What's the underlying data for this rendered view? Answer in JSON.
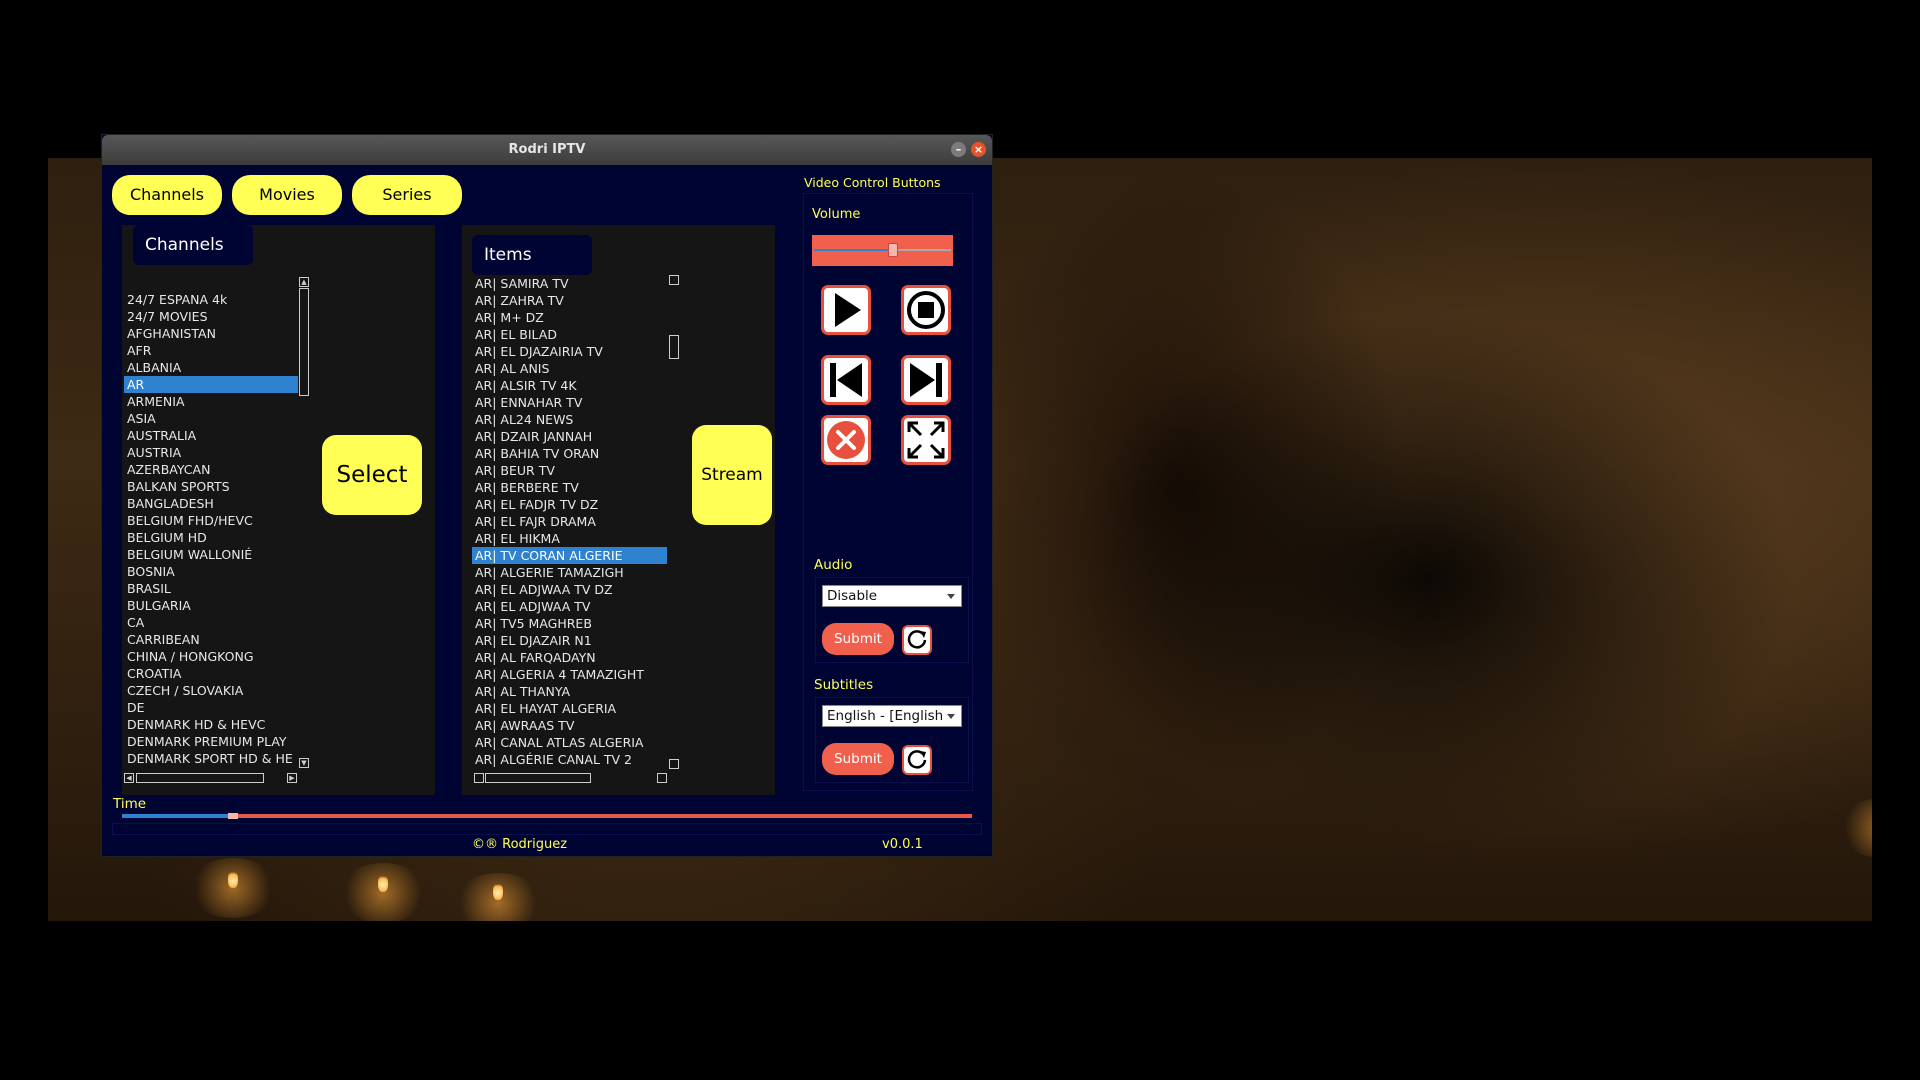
{
  "window": {
    "title": "Rodri IPTV"
  },
  "tabs": [
    {
      "label": "Channels"
    },
    {
      "label": "Movies"
    },
    {
      "label": "Series"
    }
  ],
  "channels_panel": {
    "label": "Channels",
    "items": [
      "24/7 ESPANA 4k",
      "24/7 MOVIES",
      "AFGHANISTAN",
      "AFR",
      "ALBANIA",
      "AR",
      "ARMENIA",
      "ASIA",
      "AUSTRALIA",
      "AUSTRIA",
      "AZERBAYCAN",
      "BALKAN SPORTS",
      "BANGLADESH",
      "BELGIUM FHD/HEVC",
      "BELGIUM HD",
      "BELGIUM WALLONIÉ",
      "BOSNIA",
      "BRASIL",
      "BULGARIA",
      "CA",
      "CARRIBEAN",
      "CHINA / HONGKONG",
      "CROATIA",
      "CZECH / SLOVAKIA",
      "DE",
      "DENMARK HD & HEVC",
      "DENMARK PREMIUM PLAY",
      "DENMARK SPORT HD & HE"
    ],
    "selected": "AR"
  },
  "select_button": "Select",
  "items_panel": {
    "label": "Items",
    "items": [
      "AR| SAMIRA TV",
      "AR| ZAHRA TV",
      "AR| M+ DZ",
      "AR| EL BILAD",
      "AR| EL DJAZAIRIA TV",
      "AR| AL ANIS",
      "AR|  ALSIR TV 4K",
      "AR| ENNAHAR TV",
      "AR| AL24 NEWS",
      "AR| DZAIR JANNAH",
      "AR| BAHIA TV ORAN",
      "AR| BEUR TV",
      "AR| BERBERE TV",
      "AR| EL FADJR TV DZ",
      "AR| EL FAJR DRAMA",
      "AR| EL HIKMA",
      "AR| TV CORAN ALGERIE",
      "AR| ALGERIE TAMAZIGH",
      "AR| EL ADJWAA TV DZ",
      "AR| EL ADJWAA TV",
      "AR| TV5 MAGHREB",
      "AR| EL DJAZAIR N1",
      "AR| AL FARQADAYN",
      "AR| ALGERIA 4 TAMAZIGHT",
      "AR| AL THANYA",
      "AR| EL HAYAT ALGERIA",
      "AR| AWRAAS TV",
      "AR| CANAL ATLAS ALGERIA",
      "AR| ALGÉRIE CANAL TV 2"
    ],
    "selected": "AR| TV CORAN ALGERIE"
  },
  "stream_button": "Stream",
  "controls": {
    "heading": "Video Control Buttons",
    "volume_label": "Volume",
    "volume_level": 0.58,
    "buttons": [
      "play-icon",
      "stop-icon",
      "previous-icon",
      "next-icon",
      "close-icon",
      "fullscreen-icon"
    ]
  },
  "audio": {
    "label": "Audio",
    "selected": "Disable",
    "submit": "Submit"
  },
  "subtitles": {
    "label": "Subtitles",
    "selected": "English - [English",
    "submit": "Submit"
  },
  "time": {
    "label": "Time",
    "progress": 0.125
  },
  "footer": {
    "copyright": "©® Rodriguez",
    "version": "v0.0.1"
  },
  "colors": {
    "background": "#000433",
    "accent_yellow": "#ffff55",
    "accent_red": "#f0604c",
    "selection_blue": "#2e82d0"
  }
}
